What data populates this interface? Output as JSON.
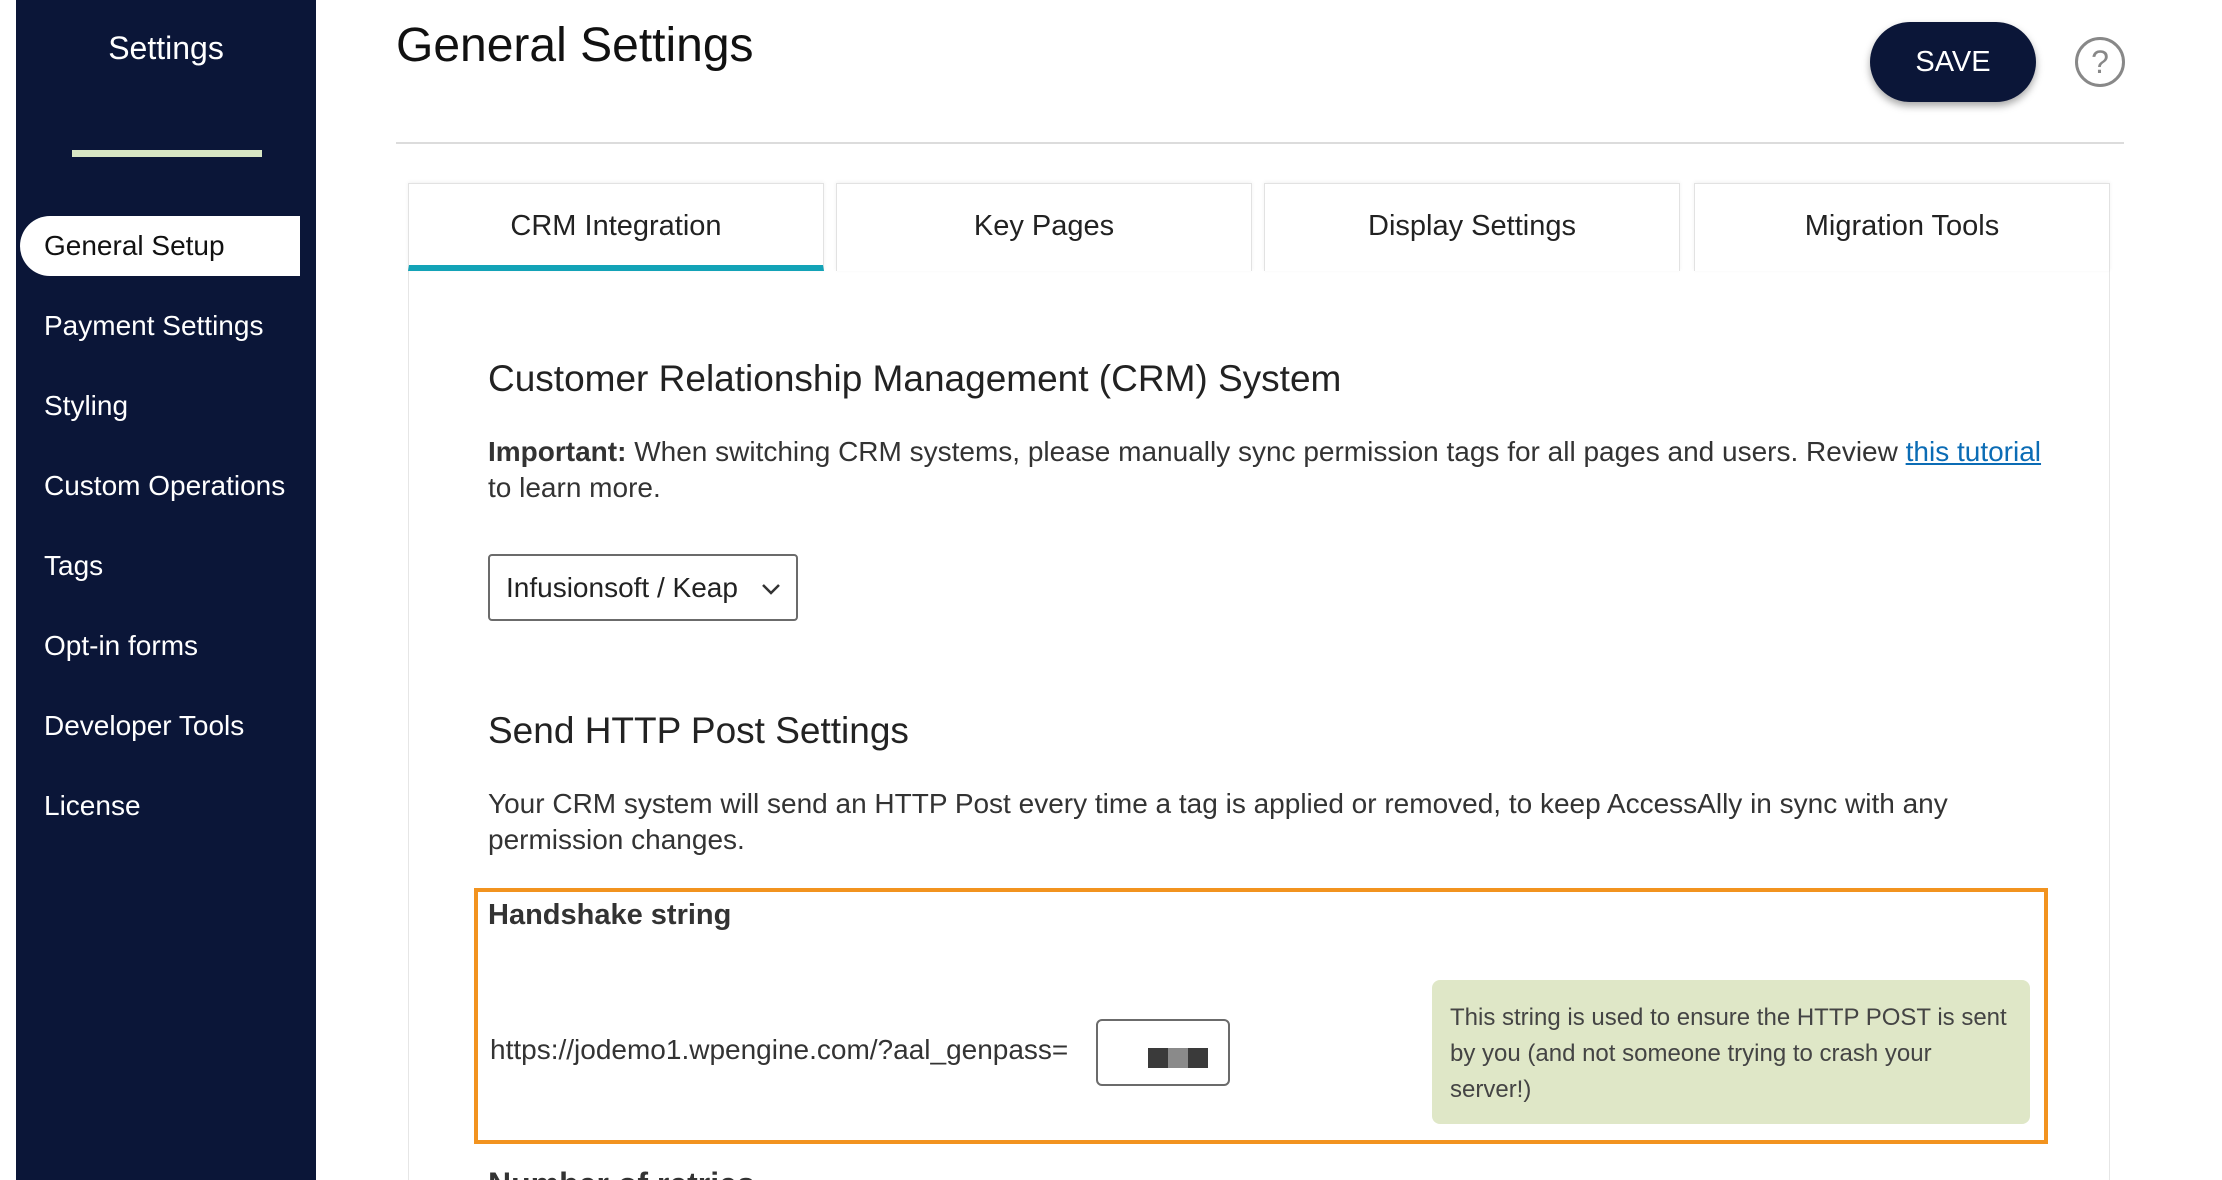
{
  "sidebar": {
    "title": "Settings",
    "items": [
      {
        "label": "General Setup",
        "active": true
      },
      {
        "label": "Payment Settings"
      },
      {
        "label": "Styling"
      },
      {
        "label": "Custom Operations"
      },
      {
        "label": "Tags"
      },
      {
        "label": "Opt-in forms"
      },
      {
        "label": "Developer Tools"
      },
      {
        "label": "License"
      }
    ]
  },
  "header": {
    "title": "General Settings",
    "save_label": "SAVE",
    "help_label": "?"
  },
  "tabs": [
    {
      "label": "CRM Integration",
      "active": true
    },
    {
      "label": "Key Pages"
    },
    {
      "label": "Display Settings"
    },
    {
      "label": "Migration Tools"
    }
  ],
  "crm": {
    "heading": "Customer Relationship Management (CRM) System",
    "important_label": "Important:",
    "important_text": " When switching CRM systems, please manually sync permission tags for all pages and users. Review ",
    "link_text": "this tutorial",
    "after_link": " to learn more.",
    "select_value": "Infusionsoft / Keap"
  },
  "http_post": {
    "heading": "Send HTTP Post Settings",
    "description": "Your CRM system will send an HTTP Post every time a tag is applied or removed, to keep AccessAlly in sync with any permission changes.",
    "handshake_label": "Handshake string",
    "url_prefix": "https://jodemo1.wpengine.com/?aal_genpass=",
    "helper_text": "This string is used to ensure the HTTP POST is sent by you (and not someone trying to crash your server!)",
    "next_heading": "Number of retries"
  },
  "colors": {
    "sidebar_bg": "#0b1638",
    "tab_active_accent": "#13a3b7",
    "highlight_border": "#f2931f",
    "helper_bg": "#dfe7c7",
    "link": "#0b6cb5"
  }
}
